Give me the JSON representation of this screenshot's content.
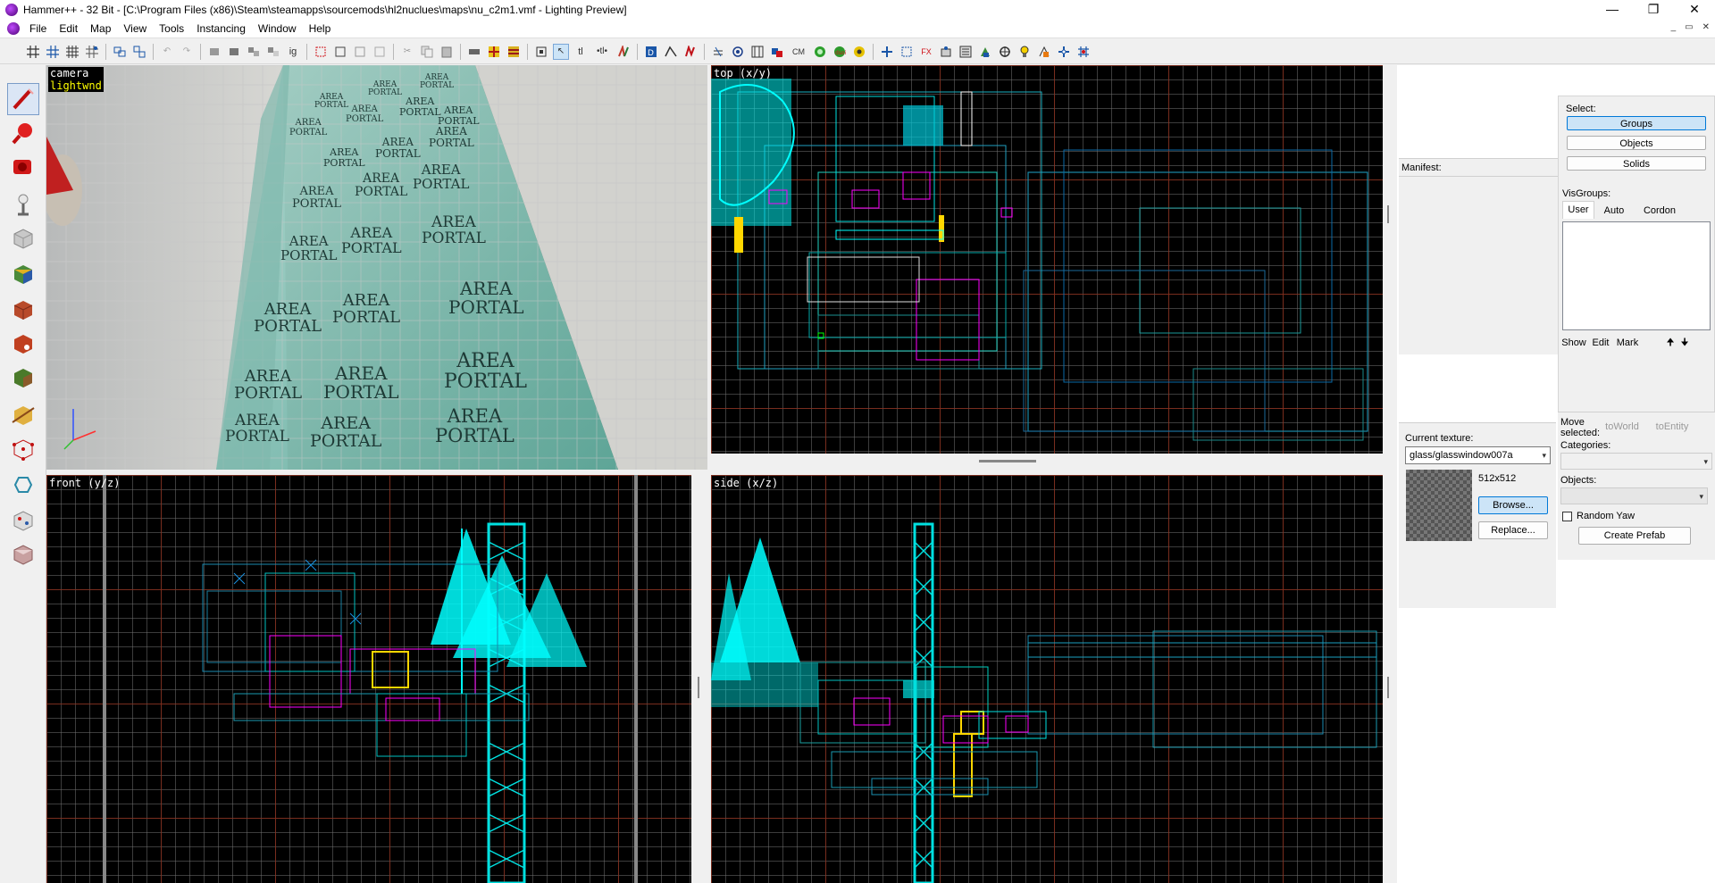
{
  "window": {
    "title": "Hammer++ - 32 Bit - [C:\\Program Files (x86)\\Steam\\steamapps\\sourcemods\\hl2nuclues\\maps\\nu_c2m1.vmf - Lighting Preview]",
    "controls": {
      "minimize": "—",
      "maximize": "❐",
      "close": "✕"
    }
  },
  "menubar": {
    "items": [
      "File",
      "Edit",
      "Map",
      "View",
      "Tools",
      "Instancing",
      "Window",
      "Help"
    ],
    "mdi": {
      "minimize": "_",
      "restore": "▭",
      "close": "✕"
    }
  },
  "toolbar": {
    "text_buttons": {
      "texlock": "tl",
      "texlock_scale": "•tl•",
      "cm": "CM"
    }
  },
  "viewports": {
    "camera": {
      "label": "camera",
      "mode": "lightwnd",
      "portal_text_line1": "AREA",
      "portal_text_line2": "PORTAL"
    },
    "top": {
      "label": "top (x/y)"
    },
    "front": {
      "label": "front (y/z)"
    },
    "side": {
      "label": "side (x/z)"
    }
  },
  "manifest": {
    "label": "Manifest:"
  },
  "select_panel": {
    "label": "Select:",
    "buttons": [
      "Groups",
      "Objects",
      "Solids"
    ],
    "selected": "Groups"
  },
  "visgroups": {
    "label": "VisGroups:",
    "tabs": [
      "User",
      "Auto",
      "Cordon"
    ],
    "active_tab": "User",
    "buttons": {
      "show": "Show",
      "edit": "Edit",
      "mark": "Mark",
      "up": "🠉",
      "down": "🠋"
    }
  },
  "texture_panel": {
    "label": "Current texture:",
    "value": "glass/glasswindow007a",
    "size": "512x512",
    "browse": "Browse...",
    "replace": "Replace..."
  },
  "entity_panel": {
    "move_selected": "Move selected:",
    "to_world": "toWorld",
    "to_entity": "toEntity",
    "categories_label": "Categories:",
    "objects_label": "Objects:",
    "random_yaw": "Random Yaw",
    "random_yaw_checked": false,
    "create_prefab": "Create Prefab"
  },
  "colors": {
    "grid_major": "#8c2814",
    "grid_minor": "#6e6e6e",
    "brush_cyan": "#00ffff",
    "brush_teal": "#00c8a0",
    "entity_magenta": "#ff00ff",
    "selection_blue": "#0078d7"
  }
}
